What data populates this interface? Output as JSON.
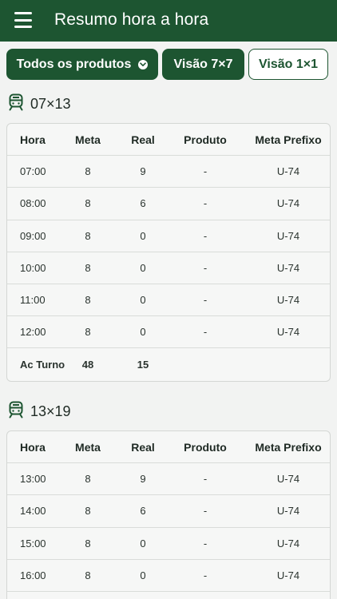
{
  "header": {
    "title": "Resumo hora a hora"
  },
  "filters": {
    "products": "Todos os produtos",
    "view_7x7": "Visão 7×7",
    "view_1x1": "Visão 1×1"
  },
  "columns": {
    "hora": "Hora",
    "meta": "Meta",
    "real": "Real",
    "produto": "Produto",
    "prefixo": "Meta Prefixo"
  },
  "shifts": [
    {
      "title": "07×13",
      "rows": [
        {
          "hora": "07:00",
          "meta": "8",
          "real": "9",
          "produto": "-",
          "prefixo": "U-74"
        },
        {
          "hora": "08:00",
          "meta": "8",
          "real": "6",
          "produto": "-",
          "prefixo": "U-74"
        },
        {
          "hora": "09:00",
          "meta": "8",
          "real": "0",
          "produto": "-",
          "prefixo": "U-74"
        },
        {
          "hora": "10:00",
          "meta": "8",
          "real": "0",
          "produto": "-",
          "prefixo": "U-74"
        },
        {
          "hora": "11:00",
          "meta": "8",
          "real": "0",
          "produto": "-",
          "prefixo": "U-74"
        },
        {
          "hora": "12:00",
          "meta": "8",
          "real": "0",
          "produto": "-",
          "prefixo": "U-74"
        }
      ],
      "total": {
        "label": "Ac Turno",
        "meta": "48",
        "real": "15"
      }
    },
    {
      "title": "13×19",
      "rows": [
        {
          "hora": "13:00",
          "meta": "8",
          "real": "9",
          "produto": "-",
          "prefixo": "U-74"
        },
        {
          "hora": "14:00",
          "meta": "8",
          "real": "6",
          "produto": "-",
          "prefixo": "U-74"
        },
        {
          "hora": "15:00",
          "meta": "8",
          "real": "0",
          "produto": "-",
          "prefixo": "U-74"
        },
        {
          "hora": "16:00",
          "meta": "8",
          "real": "0",
          "produto": "-",
          "prefixo": "U-74"
        }
      ]
    }
  ],
  "icons": {
    "menu": "hamburger-menu-icon",
    "dropdown": "chevron-down-circle-icon",
    "shift": "train-icon"
  },
  "colors": {
    "primary": "#1d5531",
    "background": "#f2f3f2"
  }
}
